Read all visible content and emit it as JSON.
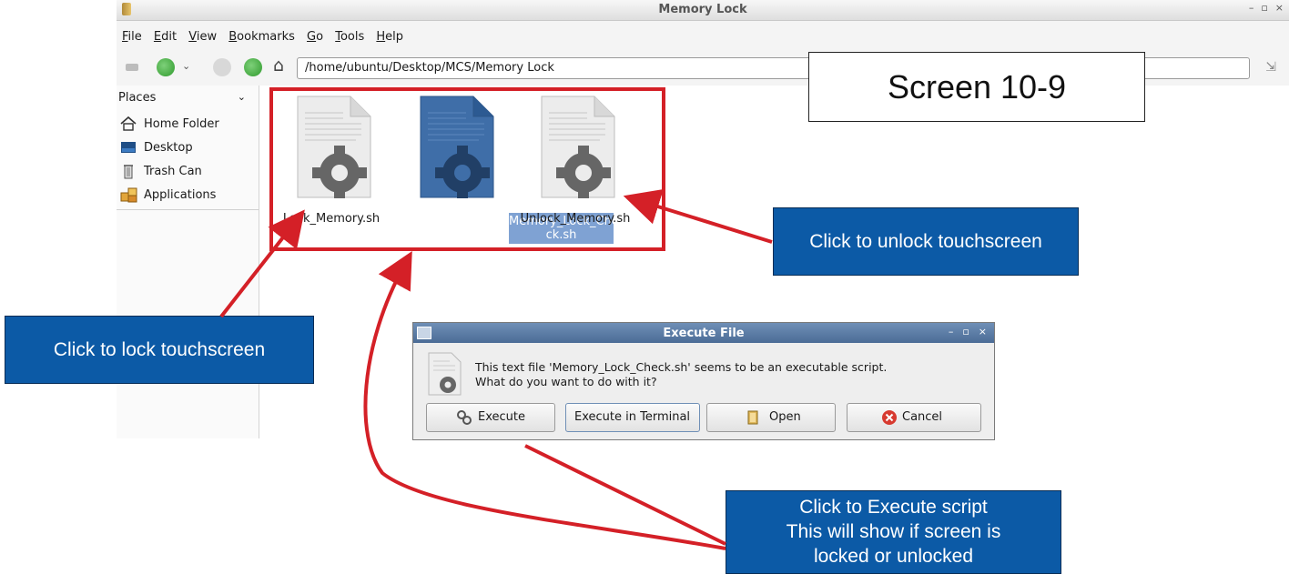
{
  "window": {
    "title": "Memory Lock",
    "controls": [
      "–",
      "▫",
      "×"
    ]
  },
  "menubar": [
    "File",
    "Edit",
    "View",
    "Bookmarks",
    "Go",
    "Tools",
    "Help"
  ],
  "toolbar": {
    "path": "/home/ubuntu/Desktop/MCS/Memory Lock"
  },
  "sidebar": {
    "header": "Places",
    "items": [
      {
        "label": "Home Folder",
        "icon": "home-icon"
      },
      {
        "label": "Desktop",
        "icon": "desktop-icon"
      },
      {
        "label": "Trash Can",
        "icon": "trash-icon"
      },
      {
        "label": "Applications",
        "icon": "applications-icon"
      }
    ]
  },
  "files": [
    {
      "name": "Lock_Memory.sh",
      "line1": "Lock_Memory.sh",
      "line2": "",
      "selected": false
    },
    {
      "name": "Memory_Lock_Check.sh",
      "line1": "Memory_Lock_Che",
      "line2": "ck.sh",
      "selected": true
    },
    {
      "name": "Unlock_Memory.sh",
      "line1": "Unlock_Memory.sh",
      "line2": "",
      "selected": false
    }
  ],
  "dialog": {
    "title": "Execute File",
    "message_line1": "This text file 'Memory_Lock_Check.sh' seems to be an executable script.",
    "message_line2": "What do you want to do with it?",
    "buttons": {
      "execute": "Execute",
      "execute_terminal": "Execute in Terminal",
      "open": "Open",
      "cancel": "Cancel"
    }
  },
  "annotations": {
    "screen_label": "Screen 10-9",
    "lock_callout": "Click to lock touchscreen",
    "unlock_callout": "Click to unlock touchscreen",
    "execute_callout_1": "Click to Execute script",
    "execute_callout_2": "This will show if screen is",
    "execute_callout_3": "locked or unlocked"
  },
  "colors": {
    "callout_blue": "#0c5aa6",
    "annotation_red": "#d42027",
    "selection_blue": "#7fa2d3"
  }
}
